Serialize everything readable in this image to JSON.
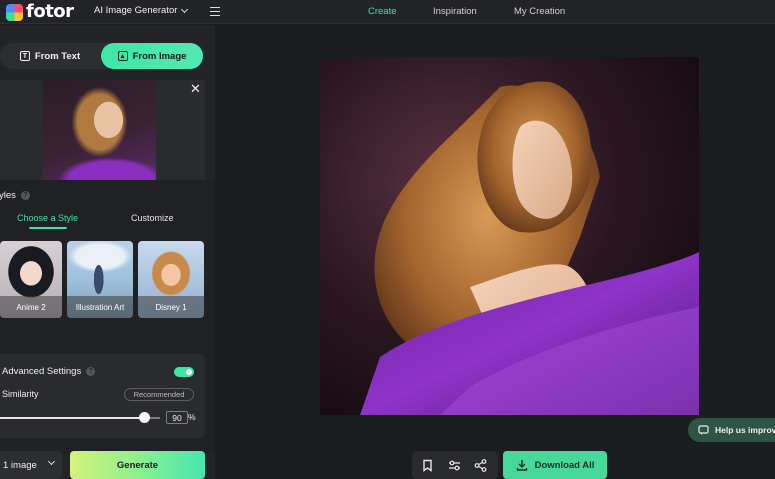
{
  "header": {
    "logo_text": "fotor",
    "tool_selector": "AI Image Generator",
    "nav": [
      {
        "label": "Create",
        "active": true
      },
      {
        "label": "Inspiration",
        "active": false
      },
      {
        "label": "My Creation",
        "active": false
      }
    ]
  },
  "left_panel": {
    "mode_tabs": [
      {
        "label": "From Text",
        "icon": "text-box-icon",
        "active": false
      },
      {
        "label": "From Image",
        "icon": "image-icon",
        "active": true
      }
    ],
    "styles": {
      "title": "Styles",
      "tabs": [
        {
          "label": "Choose a Style",
          "active": true
        },
        {
          "label": "Customize",
          "active": false
        }
      ],
      "cards": [
        {
          "label": "Anime 2"
        },
        {
          "label": "Illustration Art"
        },
        {
          "label": "Disney 1"
        }
      ]
    },
    "advanced": {
      "title": "Advanced Settings",
      "enabled": true,
      "similarity_label": "Similarity",
      "badge": "Recommended",
      "similarity_value": "90",
      "similarity_unit": "%"
    },
    "image_count": "1 image",
    "generate_label": "Generate"
  },
  "toolbar": {
    "download_label": "Download All"
  },
  "help_label": "Help us improv",
  "colors": {
    "accent": "#3be6a3",
    "background": "#1c1d20",
    "panel": "#232427"
  }
}
